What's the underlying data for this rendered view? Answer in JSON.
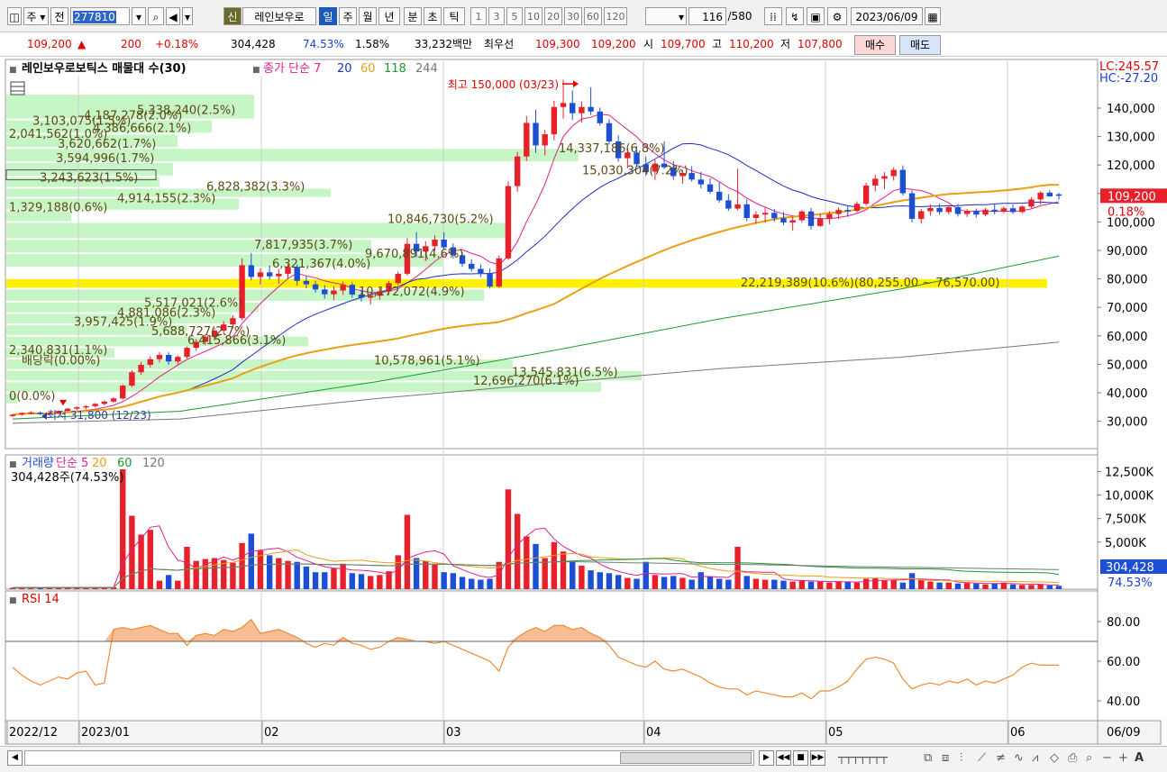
{
  "toolbar": {
    "period_label": "주",
    "type_label": "전",
    "code": "277810",
    "new_badge": "신",
    "stock_name": "레인보우로",
    "tabs": [
      "일",
      "주",
      "월",
      "년",
      "분",
      "초",
      "틱"
    ],
    "active_tab": "일",
    "periods": [
      "1",
      "3",
      "5",
      "10",
      "20",
      "30",
      "60",
      "120"
    ],
    "count": "116",
    "total": "/580",
    "date": "2023/06/09"
  },
  "quote": {
    "price": "109,200",
    "change_arrow": "▲",
    "change": "200",
    "change_pct": "+0.18%",
    "volume": "304,428",
    "vol_ratio": "74.53%",
    "turnover": "1.58%",
    "amount": "33,232백만",
    "best_label": "최우선",
    "best_ask": "109,300",
    "best_bid": "109,200",
    "open_label": "시",
    "open": "109,700",
    "high_label": "고",
    "high": "110,200",
    "low_label": "저",
    "low": "107,800",
    "buy_label": "매수",
    "sell_label": "매도"
  },
  "colors": {
    "up": "#e8202a",
    "down": "#1c4fd4",
    "ma7": "#e0208c",
    "ma20": "#1c2fbf",
    "ma60": "#e8a015",
    "ma118": "#1a9a2e",
    "ma244": "#777777",
    "profile": "#c6f5c6",
    "profile_max": "#fff200",
    "rsi": "#f08a30"
  },
  "chart_data": [
    {
      "type": "candlestick",
      "legend_prefix": "■",
      "title": "레인보우로보틱스 매물대 수(30)",
      "ma_legend": [
        {
          "label": "종가 단순 7",
          "color": "#e0208c"
        },
        {
          "label": "20",
          "color": "#1c2fbf"
        },
        {
          "label": "60",
          "color": "#e8a015"
        },
        {
          "label": "118",
          "color": "#1a9a2e"
        },
        {
          "label": "244",
          "color": "#777777"
        }
      ],
      "y_ticks": [
        "140,000",
        "130,000",
        "120,000",
        "110,000",
        "100,000",
        "90,000",
        "80,000",
        "70,000",
        "60,000",
        "50,000",
        "40,000",
        "30,000"
      ],
      "ylim": [
        24000,
        150000
      ],
      "right_top": [
        "LC:245.57",
        "HC:-27.20"
      ],
      "current_price": "109,200",
      "current_pct": "0.18%",
      "peak_annotation": "최고 150,000 (03/23)",
      "low_annotation": "최저 31,800 (12/23)",
      "profile_labels": [
        {
          "text": "5,338,240(2.5%)",
          "price": 139500
        },
        {
          "text": "4,187,278(2.0%)",
          "price": 137600
        },
        {
          "text": "3,103,075(1.5%)",
          "price": 135800
        },
        {
          "text": "4,386,666(2.1%)",
          "price": 133200
        },
        {
          "text": "2,041,562(1.0%)",
          "price": 131100
        },
        {
          "text": "3,620,662(1.7%)",
          "price": 127600
        },
        {
          "text": "3,594,996(1.7%)",
          "price": 122600
        },
        {
          "text": "14,337,186(6.8%)",
          "price": 126000
        },
        {
          "text": "15,030,304(7.2%)",
          "price": 118400
        },
        {
          "text": "3,243,623(1.5%)",
          "price": 115800
        },
        {
          "text": "6,828,382(3.3%)",
          "price": 112600
        },
        {
          "text": "4,914,155(2.3%)",
          "price": 108500
        },
        {
          "text": "1,329,188(0.6%)",
          "price": 105300
        },
        {
          "text": "10,846,730(5.2%)",
          "price": 101300
        },
        {
          "text": "7,817,935(3.7%)",
          "price": 92200
        },
        {
          "text": "9,670,891(4.6%)",
          "price": 89000
        },
        {
          "text": "6,321,367(4.0%)",
          "price": 85600
        },
        {
          "text": "22,219,389(10.6%)(80,255.00 ~ 76,570.00)",
          "price": 79000
        },
        {
          "text": "10,172,072(4.9%)",
          "price": 75800
        },
        {
          "text": "5,517,021(2.6%)",
          "price": 71800
        },
        {
          "text": "4,881,086(2.3%)",
          "price": 68400
        },
        {
          "text": "3,957,425(1.9%)",
          "price": 65200
        },
        {
          "text": "5,688,727(2.7%)",
          "price": 61800
        },
        {
          "text": "6,415,866(3.1%)",
          "price": 58600
        },
        {
          "text": "2,340,831(1.1%)",
          "price": 55200
        },
        {
          "text": "배당락(0.00%)",
          "price": 51500
        },
        {
          "text": "10,578,961(5.1%)",
          "price": 51600
        },
        {
          "text": "13,545,831(6.5%)",
          "price": 47500
        },
        {
          "text": "12,696,270(6.1%)",
          "price": 44400
        },
        {
          "text": "0(0.0%)",
          "price": 39100
        }
      ],
      "date_ticks": [
        "2022/12",
        "2023/01",
        "02",
        "03",
        "04",
        "05",
        "06"
      ],
      "date_last": "06/09"
    },
    {
      "type": "bar",
      "title_parts": [
        {
          "text": "거래량",
          "color": "#1c4fd4"
        },
        {
          "text": "단순 5",
          "color": "#e0208c"
        },
        {
          "text": "20",
          "color": "#e8a015"
        },
        {
          "text": "60",
          "color": "#1a9a2e"
        },
        {
          "text": "120",
          "color": "#777777"
        }
      ],
      "volume_note": "304,428주(74.53%)",
      "y_ticks": [
        "12,500K",
        "10,000K",
        "7,500K",
        "5,000K"
      ],
      "ylim": [
        0,
        13500
      ],
      "unit": "K",
      "current": "304,428",
      "current_pct": "74.53%"
    },
    {
      "type": "line",
      "title": "RSI 14",
      "y_ticks": [
        "80.00",
        "60.00",
        "40.00"
      ],
      "ylim": [
        30,
        90
      ],
      "levels": [
        70,
        30
      ]
    }
  ]
}
